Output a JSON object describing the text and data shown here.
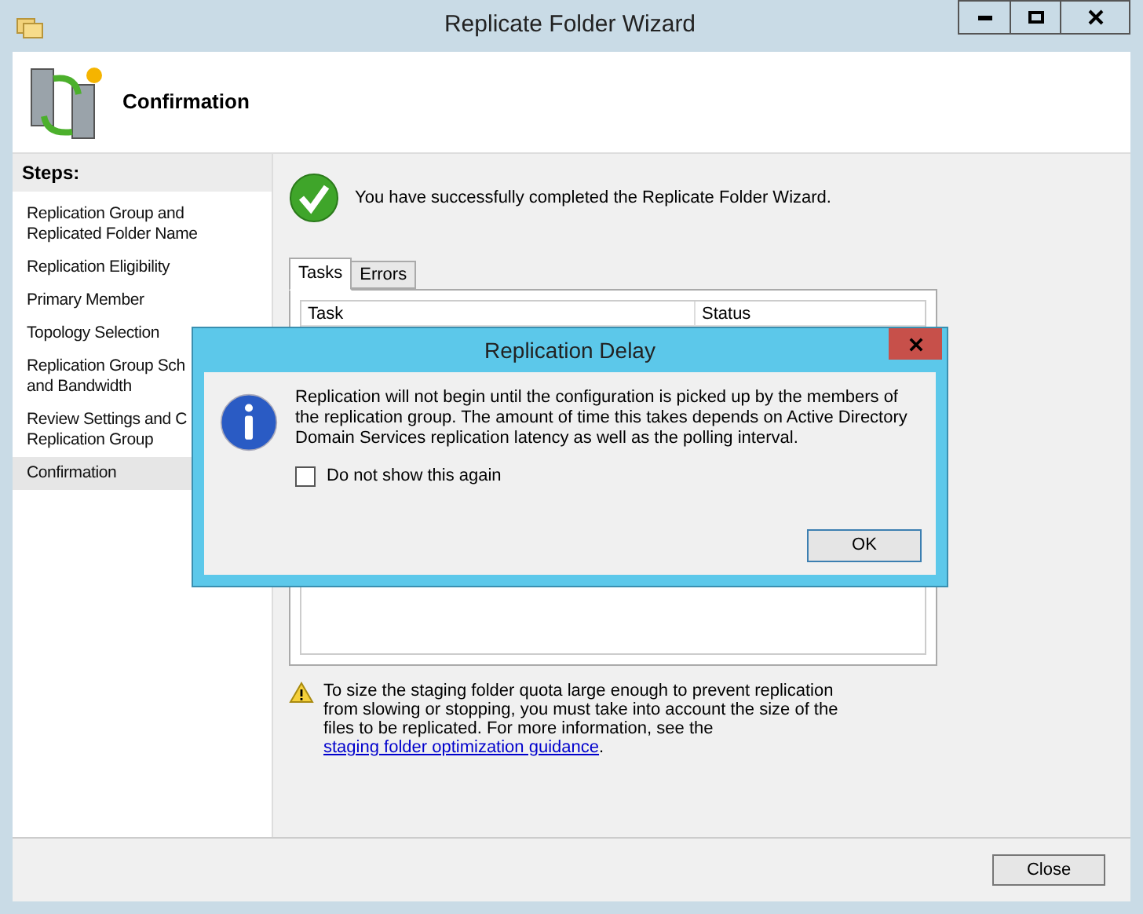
{
  "window": {
    "title": "Replicate Folder Wizard"
  },
  "header": {
    "title": "Confirmation"
  },
  "sidebar": {
    "heading": "Steps:",
    "items": [
      {
        "lines": [
          "Replication Group and",
          "Replicated Folder Name"
        ],
        "selected": false
      },
      {
        "lines": [
          "Replication Eligibility"
        ],
        "selected": false
      },
      {
        "lines": [
          "Primary Member"
        ],
        "selected": false
      },
      {
        "lines": [
          "Topology Selection"
        ],
        "selected": false
      },
      {
        "lines": [
          "Replication Group Sch",
          "and Bandwidth"
        ],
        "selected": false
      },
      {
        "lines": [
          "Review Settings and C",
          "Replication Group"
        ],
        "selected": false
      },
      {
        "lines": [
          "Confirmation"
        ],
        "selected": true
      }
    ]
  },
  "success_message": "You have successfully completed the Replicate Folder Wizard.",
  "tabs": [
    {
      "label": "Tasks",
      "selected": true
    },
    {
      "label": "Errors",
      "selected": false
    }
  ],
  "table": {
    "columns": [
      "Task",
      "Status"
    ]
  },
  "warning": {
    "text": "To size the staging folder quota large enough to prevent replication from slowing or stopping, you must take into account the size of the files to be replicated. For more information, see the ",
    "link": "staging folder optimization guidance",
    "after": "."
  },
  "close_button": "Close",
  "dialog": {
    "title": "Replication Delay",
    "message": "Replication will not begin until the configuration is picked up by the members of the replication group. The amount of time this takes depends on Active Directory Domain Services replication latency as well as the polling interval.",
    "checkbox": {
      "label": "Do not show this again",
      "checked": false
    },
    "ok_button": "OK"
  }
}
